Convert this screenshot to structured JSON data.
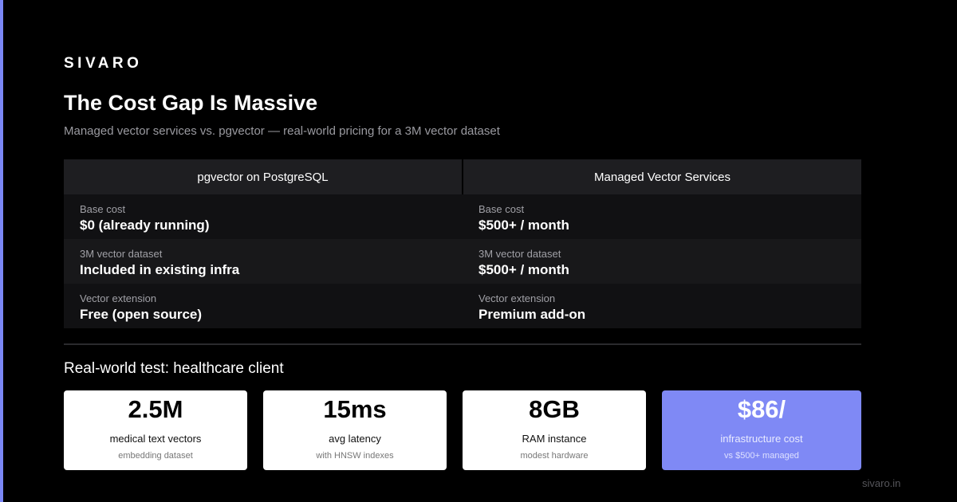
{
  "brand": "SIVARO",
  "title": "The Cost Gap Is Massive",
  "subtitle": "Managed vector services vs. pgvector — real-world pricing for a 3M vector dataset",
  "comparison": {
    "headers": [
      "pgvector on PostgreSQL",
      "Managed Vector Services"
    ],
    "rows": [
      {
        "left": {
          "label": "Base cost",
          "value": "$0 (already running)"
        },
        "right": {
          "label": "Base cost",
          "value": "$500+ / month"
        }
      },
      {
        "left": {
          "label": "3M vector dataset",
          "value": "Included in existing infra"
        },
        "right": {
          "label": "3M vector dataset",
          "value": "$500+ / month"
        }
      },
      {
        "left": {
          "label": "Vector extension",
          "value": "Free (open source)"
        },
        "right": {
          "label": "Vector extension",
          "value": "Premium add-on"
        }
      }
    ]
  },
  "section_title": "Real-world test: healthcare client",
  "stats": [
    {
      "value": "2.5M",
      "label": "medical text vectors",
      "sub": "embedding dataset"
    },
    {
      "value": "15ms",
      "label": "avg latency",
      "sub": "with HNSW indexes"
    },
    {
      "value": "8GB",
      "label": "RAM instance",
      "sub": "modest hardware"
    },
    {
      "value": "$86/",
      "label": "infrastructure cost",
      "sub": "vs $500+ managed"
    }
  ],
  "footer": "sivaro.in",
  "colors": {
    "accent": "#7f89f5",
    "background": "#000000"
  }
}
